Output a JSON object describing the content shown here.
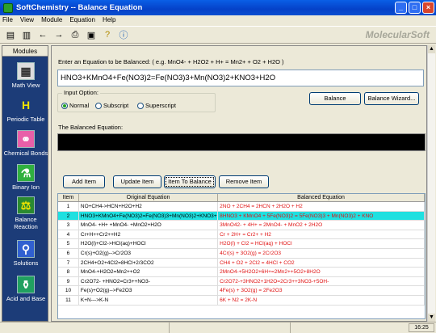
{
  "window": {
    "title": "SoftChemistry -- Balance Equation"
  },
  "menu": [
    "File",
    "View",
    "Module",
    "Equation",
    "Help"
  ],
  "toolbar": {
    "brand": "MolecularSoft",
    "buttons": [
      "view-icon",
      "layout-icon",
      "back-icon",
      "forward-icon",
      "print-icon",
      "print-preview-icon",
      "hint-icon",
      "info-icon"
    ]
  },
  "sidebar": {
    "header": "Modules",
    "items": [
      {
        "label": "Math View",
        "icon": "calculator-icon"
      },
      {
        "label": "Periodic Table",
        "icon": "periodic-table-icon"
      },
      {
        "label": "Chemical Bonds",
        "icon": "bonds-icon"
      },
      {
        "label": "Binary Ion",
        "icon": "binary-ion-icon"
      },
      {
        "label": "Balance Reaction",
        "icon": "balance-icon"
      },
      {
        "label": "Solutions",
        "icon": "flask-icon"
      },
      {
        "label": "Acid and Base",
        "icon": "beaker-icon"
      }
    ]
  },
  "form": {
    "prompt": "Enter an Equation to be Balanced:  ( e.g. MnO4- + H2O2 + H+ = Mn2+ + O2 + H2O )",
    "equation": "HNO3+KMnO4+Fe(NO3)2=Fe(NO3)3+Mn(NO3)2+KNO3+H2O",
    "input_option": "Input Option:",
    "options": [
      "Normal",
      "Subscript",
      "Superscript"
    ],
    "selected_option": "Normal",
    "balance_label": "Balance",
    "wizard_label": "Balance Wizard...",
    "result_label": "The Balanced Equation:",
    "result_value": "",
    "buttons": [
      "Add Item",
      "Update Item",
      "Item To Balance",
      "Remove Item"
    ]
  },
  "table": {
    "headers": [
      "Item",
      "Original Equation",
      "Balanced Equation"
    ],
    "selected_row": 2,
    "rows": [
      [
        "1",
        "NO+CH4->HCN+H2O+H2",
        "2NO + 2CH4 = 2HCN + 2H2O + H2"
      ],
      [
        "2",
        "HNO3+KMnO4+Fe(NO3)2=Fe(NO3)3+Mn(NO3)2+KNO3+",
        "8HNO3 + KMnO4 + 5Fe(NO3)2 = 5Fe(NO3)3 + Mn(NO3)2 + KNO"
      ],
      [
        "3",
        "MnO4- +H+ +MnO4- +MnO2+H2O",
        "3MnO42- + 4H+ = 2MnO4- + MnO2 + 2H2O"
      ],
      [
        "4",
        "Cr+H++Cr2++H2",
        "Cr + 2H+ = Cr2+ + H2"
      ],
      [
        "5",
        "H2O(l)+Cl2->HCl(aq)+HOCl",
        "H2O(l) + Cl2 = HCl(aq) + HOCl"
      ],
      [
        "6",
        "Cr(s)+O2(g)-->Cr2O3",
        "4Cr(s) + 3O2(g) = 2Cr2O3"
      ],
      [
        "7",
        "2CH4+O2+4Cl2=8HCl+2/3CO2",
        "CH4 + O2 + 2Cl2 = 4HCl + CO2"
      ],
      [
        "8",
        "MnO4-+H2O2=Mn2++O2",
        "2MnO4-+5H2O2+6H+=2Mn2++5O2+8H2O"
      ],
      [
        "9",
        "Cr2O72- +HNO2=Cr3++NO3-",
        "Cr2O72-+3HNO2+1H2O=2Cr3++3NO3-+5OH-"
      ],
      [
        "10",
        "Fe(s)+O2(g)-->Fe2O3",
        "4Fe(s) + 3O2(g) = 2Fe2O3"
      ],
      [
        "11",
        "K+N--->K-N",
        "6K + N2 = 2K-N"
      ]
    ]
  },
  "status": {
    "time": "16:25"
  }
}
